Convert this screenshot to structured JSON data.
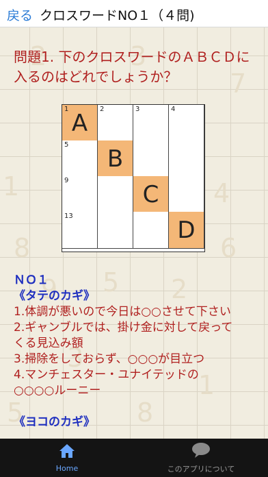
{
  "header": {
    "back_label": "戻る",
    "title": "クロスワードNO１（４問)"
  },
  "question": {
    "text": "問題1. 下のクロスワードのＡＢＣＤに入るのはどれでしょうか？"
  },
  "crossword": {
    "rows": [
      [
        {
          "num": "1",
          "letter": "A",
          "highlight": true
        },
        {
          "num": "2",
          "letter": "",
          "highlight": false
        },
        {
          "num": "3",
          "letter": "",
          "highlight": false
        },
        {
          "num": "4",
          "letter": "",
          "highlight": false
        }
      ],
      [
        {
          "num": "5",
          "letter": "",
          "highlight": false
        },
        {
          "num": "",
          "letter": "B",
          "highlight": true
        },
        {
          "num": "",
          "letter": "",
          "highlight": false
        },
        {
          "num": "",
          "letter": "",
          "highlight": false
        }
      ],
      [
        {
          "num": "9",
          "letter": "",
          "highlight": false
        },
        {
          "num": "",
          "letter": "",
          "highlight": false
        },
        {
          "num": "",
          "letter": "C",
          "highlight": true
        },
        {
          "num": "",
          "letter": "",
          "highlight": false
        }
      ],
      [
        {
          "num": "13",
          "letter": "",
          "highlight": false
        },
        {
          "num": "",
          "letter": "",
          "highlight": false
        },
        {
          "num": "",
          "letter": "",
          "highlight": false
        },
        {
          "num": "",
          "letter": "D",
          "highlight": true
        }
      ]
    ]
  },
  "clues": {
    "puzzle_title": "ＮＯ１",
    "tate_header": "《タテのカギ》",
    "tate_lines": [
      "1.体調が悪いので今日は○○させて下さい",
      "2.ギャンブルでは、掛け金に対して戻って",
      "くる見込み額",
      "3.掃除をしておらず、○○○が目立つ",
      "4.マンチェスター・ユナイテッドの",
      "○○○○ルーニー"
    ],
    "yoko_header": "《ヨコのカギ》"
  },
  "tabbar": {
    "home_label": "Home",
    "about_label": "このアプリについて"
  },
  "colors": {
    "accent_blue": "#2a7bd6",
    "question_red": "#b0201f",
    "clue_header_blue": "#1f2fbf",
    "highlight_orange": "#f4b777",
    "tabbar_bg": "#141414"
  }
}
